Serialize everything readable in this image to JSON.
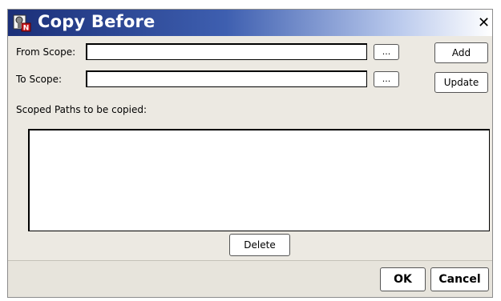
{
  "dialog": {
    "title": "Copy Before",
    "icon": "scope-copy-icon",
    "close_label": "✕"
  },
  "form": {
    "from_scope_label": "From Scope:",
    "from_scope_value": "",
    "from_browse_label": "...",
    "to_scope_label": "To Scope:",
    "to_scope_value": "",
    "to_browse_label": "...",
    "add_label": "Add",
    "update_label": "Update",
    "paths_label": "Scoped Paths to be copied:",
    "paths": [],
    "delete_label": "Delete"
  },
  "footer": {
    "ok_label": "OK",
    "cancel_label": "Cancel"
  },
  "colors": {
    "titlebar_start": "#1b2f78",
    "titlebar_end": "#ffffff",
    "dialog_bg": "#ece9e2"
  }
}
